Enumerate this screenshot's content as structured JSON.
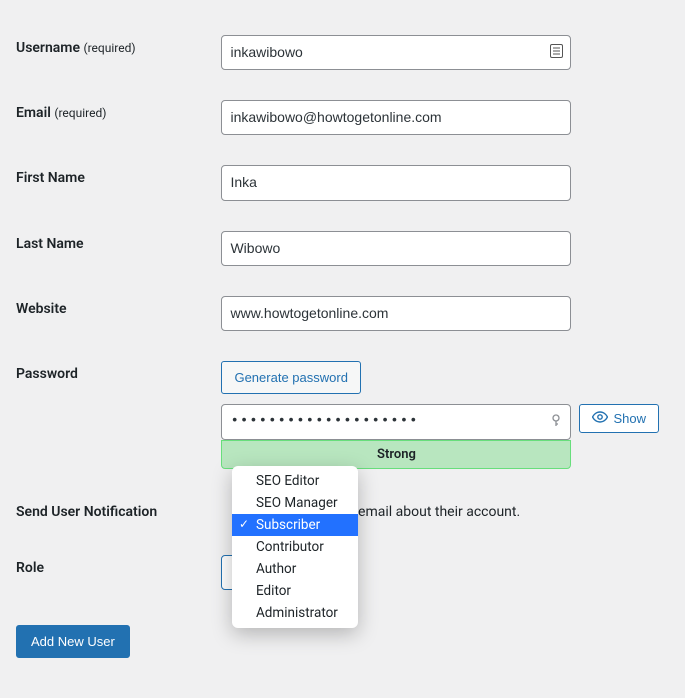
{
  "labels": {
    "username": "Username",
    "username_req": "(required)",
    "email": "Email",
    "email_req": "(required)",
    "first_name": "First Name",
    "last_name": "Last Name",
    "website": "Website",
    "password": "Password",
    "generate_password": "Generate password",
    "show": "Show",
    "strength": "Strong",
    "send_notif": "Send User Notification",
    "notif_desc_suffix": "ser an email about their account.",
    "role": "Role",
    "submit": "Add New User"
  },
  "values": {
    "username": "inkawibowo",
    "email": "inkawibowo@howtogetonline.com",
    "first_name": "Inka",
    "last_name": "Wibowo",
    "website": "www.howtogetonline.com",
    "password_masked": "••••••••••••••••••••"
  },
  "role_options": [
    {
      "label": "SEO Editor",
      "selected": false
    },
    {
      "label": "SEO Manager",
      "selected": false
    },
    {
      "label": "Subscriber",
      "selected": true
    },
    {
      "label": "Contributor",
      "selected": false
    },
    {
      "label": "Author",
      "selected": false
    },
    {
      "label": "Editor",
      "selected": false
    },
    {
      "label": "Administrator",
      "selected": false
    }
  ]
}
